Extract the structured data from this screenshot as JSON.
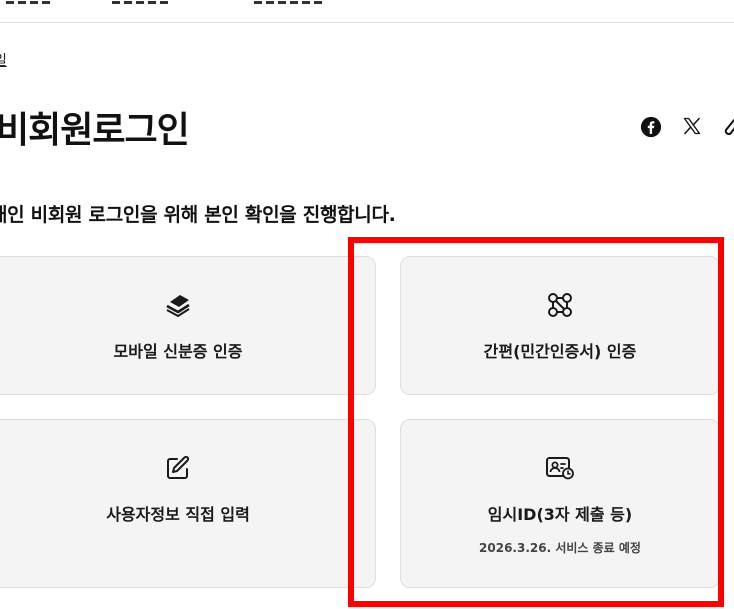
{
  "breadcrumb": {
    "label": "일"
  },
  "page": {
    "title": "비회원로그인"
  },
  "subtitle": "개인 비회원 로그인을 위해 본인 확인을 진행합니다.",
  "share": {
    "icons": [
      "facebook-icon",
      "x-icon",
      "link-icon"
    ]
  },
  "auth_options": [
    {
      "icon": "mobile-id-icon",
      "label": "모바일 신분증 인증",
      "note": ""
    },
    {
      "icon": "simple-auth-icon",
      "label": "간편(민간인증서) 인증",
      "note": ""
    },
    {
      "icon": "edit-icon",
      "label": "사용자정보 직접 입력",
      "note": ""
    },
    {
      "icon": "temp-id-icon",
      "label": "임시ID(3자 제출 등)",
      "note": "2026.3.26. 서비스 종료 예정"
    }
  ],
  "colors": {
    "card_bg": "#f4f4f5",
    "card_border": "#dedede",
    "highlight": "#ff0000",
    "text": "#111111"
  }
}
